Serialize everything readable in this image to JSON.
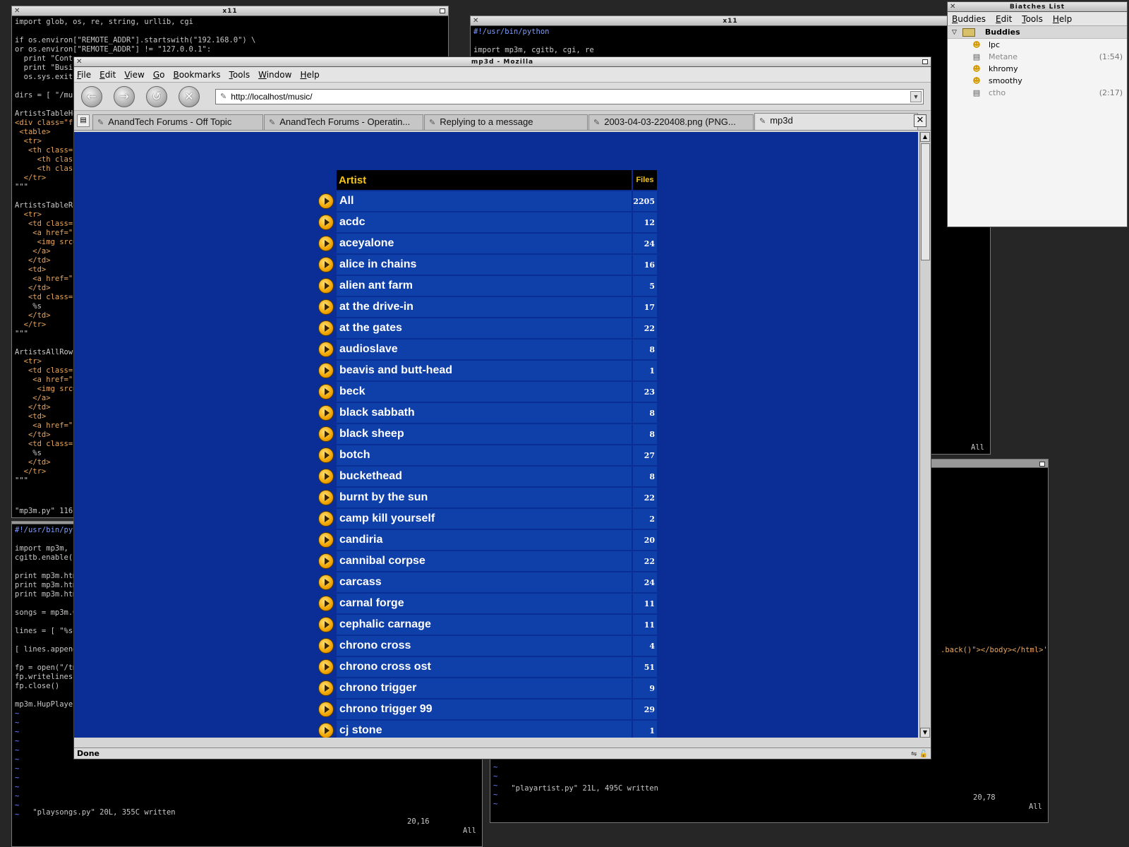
{
  "term_left": {
    "title": "x11",
    "lines": [
      "import glob, os, re, string, urllib, cgi",
      "",
      "if os.environ[\"REMOTE_ADDR\"].startswith(\"192.168.0\") \\",
      "or os.environ[\"REMOTE_ADDR\"] != \"127.0.0.1\":",
      "  print \"Conte",
      "  print \"Busin",
      "  os.sys.exit(",
      "",
      "dirs = [ \"/mus",
      "",
      "ArtistsTableHe",
      "<div class=\"fi",
      " <table>",
      "  <tr>",
      "   <th class=\"",
      "     <th class",
      "     <th class",
      "  </tr>",
      "\"\"\"",
      "",
      "ArtistsTableRo",
      "  <tr>",
      "   <td class=\"",
      "    <a href=\"p",
      "     <img src=",
      "    </a>",
      "   </td>",
      "   <td>",
      "    <a href=\"s",
      "   </td>",
      "   <td class=\"",
      "    %s",
      "   </td>",
      "  </tr>",
      "\"\"\"",
      "",
      "ArtistsAllRow",
      "  <tr>",
      "   <td class=\"",
      "    <a href=\"p",
      "     <img src=",
      "    </a>",
      "   </td>",
      "   <td>",
      "    <a href=\"s",
      "   </td>",
      "   <td class=\"",
      "    %s",
      "   </td>",
      "  </tr>",
      "\"\"\""
    ],
    "status": "\"mp3m.py\" 116L"
  },
  "term_bottom_left": {
    "lines": [
      "#!/usr/bin/pyt",
      "",
      "import mp3m, c",
      "cgitb.enable()",
      "",
      "print mp3m.htm",
      "print mp3m.htm",
      "print mp3m.htm",
      "",
      "songs = mp3m.G",
      "",
      "lines = [ \"%so",
      "",
      "[ lines.append",
      "",
      "fp = open(\"/tm",
      "fp.writelines(",
      "fp.close()",
      "",
      "mp3m.HupPlayer"
    ],
    "status_left": "\"playsongs.py\" 20L, 355C written",
    "status_pos": "20,16",
    "status_all": "All"
  },
  "term_top_right": {
    "title": "x11",
    "lines": [
      "#!/usr/bin/python",
      "",
      "import mp3m, cgitb, cgi, re"
    ],
    "status_all": "All"
  },
  "term_bottom_right": {
    "fragment": ".back()\"></body></html>'",
    "status_left": "\"playartist.py\" 21L, 495C written",
    "status_pos": "20,78",
    "status_all": "All"
  },
  "mozilla": {
    "title": "mp3d - Mozilla",
    "menu": [
      "File",
      "Edit",
      "View",
      "Go",
      "Bookmarks",
      "Tools",
      "Window",
      "Help"
    ],
    "url": "http://localhost/music/",
    "tabs": [
      "AnandTech Forums - Off Topic",
      "AnandTech Forums - Operatin...",
      "Replying to a message",
      "2003-04-03-220408.png (PNG...",
      "mp3d"
    ],
    "status": "Done",
    "table": {
      "header_artist": "Artist",
      "header_files": "Files",
      "rows": [
        {
          "name": "All",
          "count": "2205"
        },
        {
          "name": "acdc",
          "count": "12"
        },
        {
          "name": "aceyalone",
          "count": "24"
        },
        {
          "name": "alice in chains",
          "count": "16"
        },
        {
          "name": "alien ant farm",
          "count": "5"
        },
        {
          "name": "at the drive-in",
          "count": "17"
        },
        {
          "name": "at the gates",
          "count": "22"
        },
        {
          "name": "audioslave",
          "count": "8"
        },
        {
          "name": "beavis and butt-head",
          "count": "1"
        },
        {
          "name": "beck",
          "count": "23"
        },
        {
          "name": "black sabbath",
          "count": "8"
        },
        {
          "name": "black sheep",
          "count": "8"
        },
        {
          "name": "botch",
          "count": "27"
        },
        {
          "name": "buckethead",
          "count": "8"
        },
        {
          "name": "burnt by the sun",
          "count": "22"
        },
        {
          "name": "camp kill yourself",
          "count": "2"
        },
        {
          "name": "candiria",
          "count": "20"
        },
        {
          "name": "cannibal corpse",
          "count": "22"
        },
        {
          "name": "carcass",
          "count": "24"
        },
        {
          "name": "carnal forge",
          "count": "11"
        },
        {
          "name": "cephalic carnage",
          "count": "11"
        },
        {
          "name": "chrono cross",
          "count": "4"
        },
        {
          "name": "chrono cross ost",
          "count": "51"
        },
        {
          "name": "chrono trigger",
          "count": "9"
        },
        {
          "name": "chrono trigger 99",
          "count": "29"
        },
        {
          "name": "cj stone",
          "count": "1"
        }
      ]
    }
  },
  "buddy_list": {
    "title": "Biatches List",
    "menu": [
      "Buddies",
      "Edit",
      "Tools",
      "Help"
    ],
    "group": "Buddies",
    "buddies": [
      {
        "name": "lpc",
        "status": "online",
        "time": ""
      },
      {
        "name": "Metane",
        "status": "idle",
        "time": "(1:54)"
      },
      {
        "name": "khromy",
        "status": "online",
        "time": ""
      },
      {
        "name": "smoothy",
        "status": "online",
        "time": ""
      },
      {
        "name": "ctho",
        "status": "idle",
        "time": "(2:17)"
      }
    ]
  }
}
